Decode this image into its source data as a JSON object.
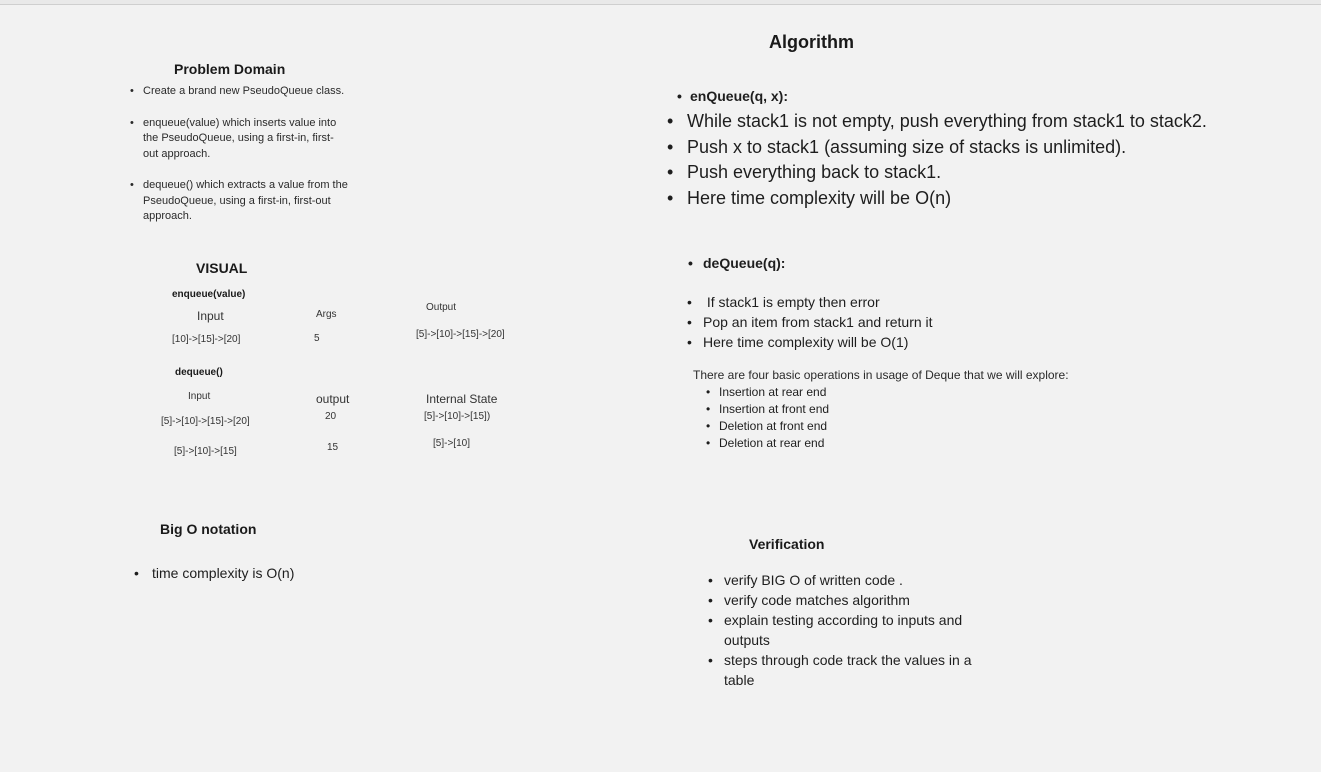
{
  "problem_domain": {
    "title": "Problem Domain",
    "items": [
      "Create a brand new PseudoQueue class.",
      "enqueue(value) which inserts value into the PseudoQueue, using a first-in, first-out approach.",
      "dequeue() which extracts a value from the PseudoQueue, using a first-in, first-out approach."
    ]
  },
  "visual": {
    "title": "VISUAL",
    "enqueue": {
      "title": "enqueue(value)",
      "headers": {
        "input": "Input",
        "args": "Args",
        "output": "Output"
      },
      "row": {
        "input": "[10]->[15]->[20]",
        "args": "5",
        "output": "[5]->[10]->[15]->[20]"
      }
    },
    "dequeue": {
      "title": "dequeue()",
      "headers": {
        "input": "Input",
        "output": "output",
        "internal": "Internal State"
      },
      "rows": [
        {
          "input": "[5]->[10]->[15]->[20]",
          "output": "20",
          "internal": "[5]->[10]->[15])"
        },
        {
          "input": "[5]->[10]->[15]",
          "output": "15",
          "internal": "[5]->[10]"
        }
      ]
    }
  },
  "big_o": {
    "title": "Big O notation",
    "items": [
      "time complexity is O(n)"
    ]
  },
  "algorithm": {
    "title": "Algorithm",
    "enqueue_heading": "enQueue(q, x):",
    "enqueue_steps": [
      "While stack1 is not empty, push everything from stack1 to stack2.",
      "Push x to stack1 (assuming size of stacks is unlimited).",
      " Push everything back to stack1.",
      "Here time complexity will be O(n)"
    ],
    "dequeue_heading": "deQueue(q):",
    "dequeue_steps": [
      " If stack1 is empty then error",
      "Pop an item from stack1 and return it",
      "Here time complexity will be O(1)"
    ],
    "deque_intro": "There are four basic operations in usage of Deque that we will explore:",
    "deque_ops": [
      "Insertion at rear end",
      "Insertion at front end",
      "Deletion at front end",
      "Deletion at rear end"
    ]
  },
  "verification": {
    "title": "Verification",
    "items": [
      "verify BIG O of written code .",
      "verify code matches algorithm",
      "explain testing according to inputs and outputs",
      "steps through code track the values in a table"
    ]
  }
}
